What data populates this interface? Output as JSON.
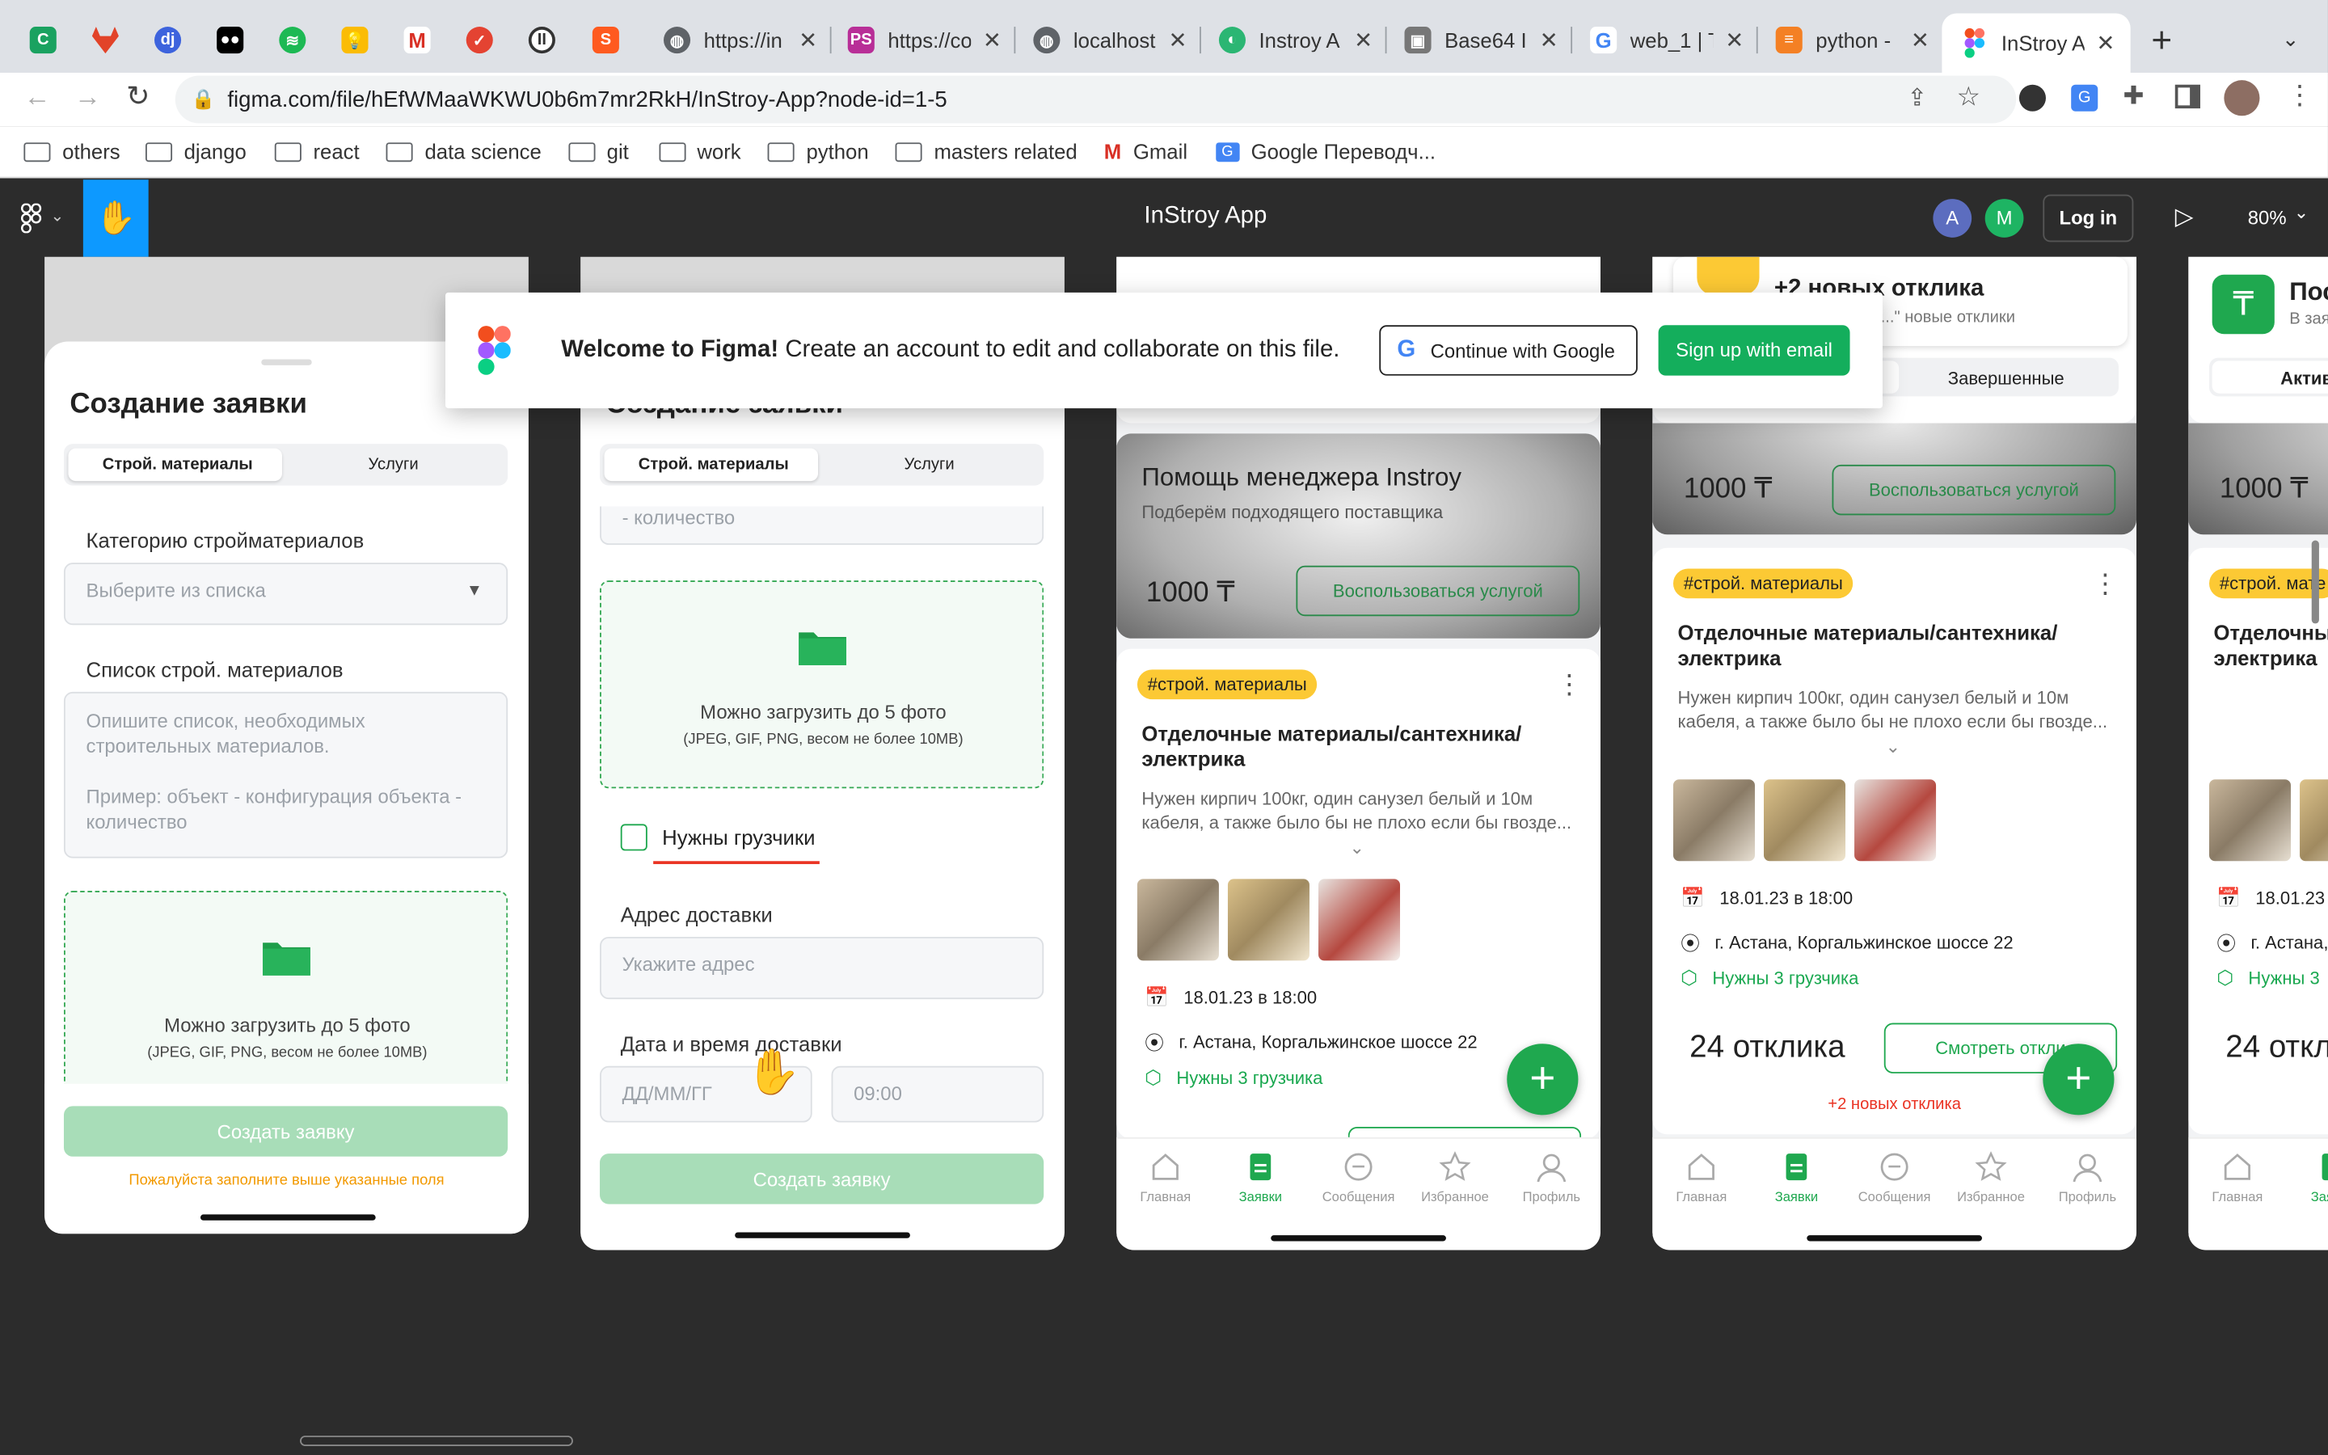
{
  "browser": {
    "tabs": [
      {
        "label": "https://in",
        "icon": "globe-icon"
      },
      {
        "label": "https://co",
        "icon": "ps-icon"
      },
      {
        "label": "localhost",
        "icon": "globe-icon"
      },
      {
        "label": "Instroy A",
        "icon": "instroy-icon"
      },
      {
        "label": "Base64 I",
        "icon": "image-icon"
      },
      {
        "label": "web_1 | T",
        "icon": "google-icon"
      },
      {
        "label": "python -",
        "icon": "stackoverflow-icon"
      },
      {
        "label": "InStroy A",
        "icon": "figma-icon"
      }
    ],
    "url": "figma.com/file/hEfWMaaWKWU0b6m7mr2RkH/InStroy-App?node-id=1-5",
    "bookmarks": [
      "others",
      "django",
      "react",
      "data science",
      "git",
      "work",
      "python",
      "masters related",
      "Gmail",
      "Google Переводч..."
    ]
  },
  "figma": {
    "file_title": "InStroy App",
    "avatars": [
      "A",
      "M"
    ],
    "login": "Log in",
    "zoom": "80%",
    "banner": {
      "bold": "Welcome to Figma!",
      "text": " Create an account to edit and collaborate on this file.",
      "google": "Continue with Google",
      "email": "Sign up with email"
    }
  },
  "frame1": {
    "title": "Создание заявки",
    "tab_a": "Строй. материалы",
    "tab_b": "Услуги",
    "cat_label": "Категорию стройматериалов",
    "cat_placeholder": "Выберите из списка",
    "list_label": "Список строй. материалов",
    "list_placeholder_1": "Опишите список, необходимых строительных материалов.",
    "list_placeholder_2": "Пример: объект - конфигурация объекта - количество",
    "upload": "Можно загрузить до 5 фото",
    "upload_hint": "(JPEG, GIF, PNG, весом не более 10MB)",
    "submit": "Создать заявку",
    "error": "Пожалуйста заполните выше указанные поля"
  },
  "frame2": {
    "title": "Создание заявки",
    "tab_a": "Строй. материалы",
    "tab_b": "Услуги",
    "list_tail": "- количество",
    "upload": "Можно загрузить до 5 фото",
    "upload_hint": "(JPEG, GIF, PNG, весом не более 10MB)",
    "movers": "Нужны грузчики",
    "addr_label": "Адрес доставки",
    "addr_placeholder": "Укажите адрес",
    "date_label": "Дата и время доставки",
    "date_placeholder": "ДД/ММ/ГГ",
    "time_placeholder": "09:00",
    "submit": "Создать заявку"
  },
  "frame3": {
    "promo_title": "Помощь менеджера Instroy",
    "promo_sub": "Подберём подходящего поставщика",
    "price": "1000 ₸",
    "promo_btn": "Воспользоваться услугой",
    "tag": "#строй. материалы",
    "card_title": "Отделочные материалы/сантехника/электрика",
    "card_desc": "Нужен кирпич 100кг, один санузел белый и 10м кабеля, а также было бы не плохо если бы гвозде...",
    "date": "18.01.23 в 18:00",
    "address": "г. Астана, Коргальжинское шоссе 22",
    "movers": "Нужны 3 грузчика"
  },
  "frame4": {
    "new_responses": "+2 новых отклика",
    "new_sub": "ьные материа...\" новые отклики",
    "tab_done": "Завершенные",
    "price": "1000 ₸",
    "promo_btn": "Воспользоваться услугой",
    "tag": "#строй. материалы",
    "card_title": "Отделочные материалы/сантехника/электрика",
    "card_desc": "Нужен кирпич 100кг, один санузел белый и 10м кабеля, а также было бы не плохо если бы гвозде...",
    "date": "18.01.23 в 18:00",
    "address": "г. Астана, Коргальжинское шоссе 22",
    "movers": "Нужны 3 грузчика",
    "responses": "24 отклика",
    "view_btn": "Смотреть откли",
    "new_link": "+2 новых отклика"
  },
  "frame5": {
    "header": "Пос",
    "header_sub": "В заяв",
    "tab_active": "Актив",
    "price": "1000 ₸",
    "tag": "#строй. мате",
    "card_title": "Отделочны электрика",
    "date": "18.01.23",
    "address": "г. Астана,",
    "movers": "Нужны 3",
    "responses": "24 откл"
  },
  "nav": [
    "Главная",
    "Заявки",
    "Сообщения",
    "Избранное",
    "Профиль"
  ]
}
